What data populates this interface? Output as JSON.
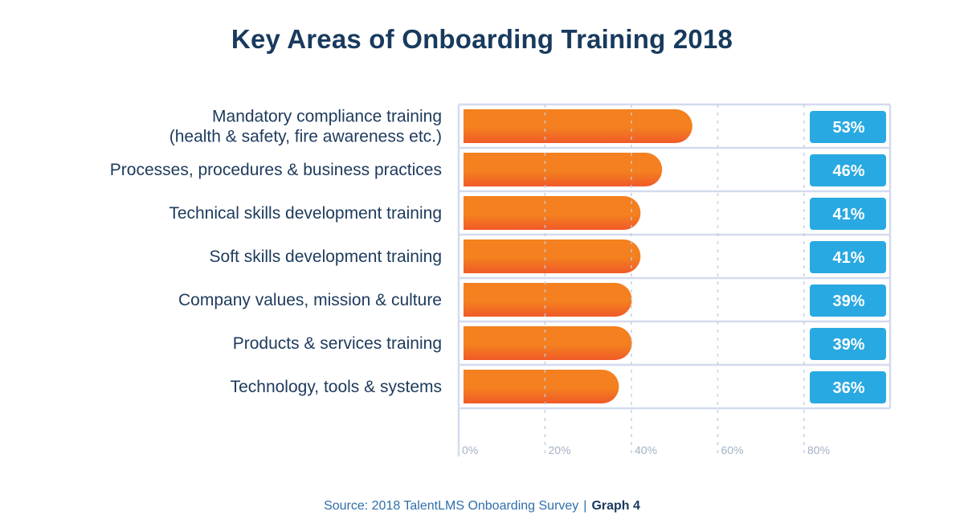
{
  "chart_data": {
    "type": "bar",
    "orientation": "horizontal",
    "title": "Key Areas of Onboarding Training 2018",
    "categories": [
      [
        "Mandatory compliance training",
        "(health & safety, fire awareness etc.)"
      ],
      [
        "Processes, procedures & business practices"
      ],
      [
        "Technical skills development training"
      ],
      [
        "Soft skills development training"
      ],
      [
        "Company values, mission & culture"
      ],
      [
        "Products & services training"
      ],
      [
        "Technology, tools & systems"
      ]
    ],
    "values": [
      53,
      46,
      41,
      41,
      39,
      39,
      36
    ],
    "value_labels": [
      "53%",
      "46%",
      "41%",
      "41%",
      "39%",
      "39%",
      "36%"
    ],
    "xlabel": "",
    "ylabel": "",
    "xlim": [
      0,
      100
    ],
    "x_ticks": [
      0,
      20,
      40,
      60,
      80
    ],
    "x_tick_labels": [
      "0%",
      "20%",
      "40%",
      "60%",
      "80%"
    ],
    "grid": true,
    "legend": "none",
    "colors": {
      "bar_top": "#f4801f",
      "bar_bottom": "#f05a28",
      "value_box": "#29a9e1",
      "frame": "#d3dbef",
      "grid": "#c3ccdb"
    }
  },
  "footer": {
    "source": "Source: 2018 TalentLMS Onboarding Survey",
    "separator": "|",
    "graph": "Graph 4"
  }
}
